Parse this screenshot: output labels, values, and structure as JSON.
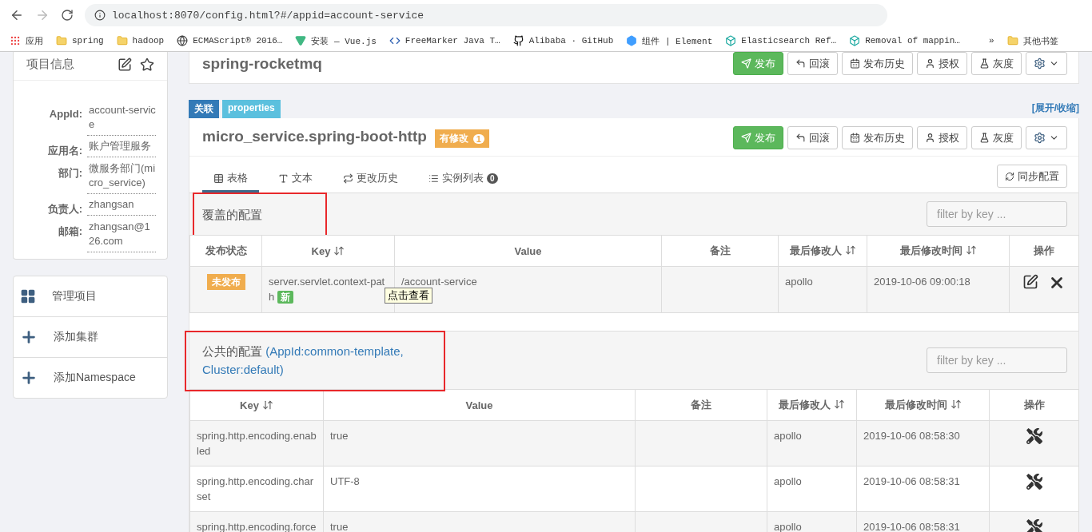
{
  "browser": {
    "address": "localhost:8070/config.html?#/appid=account-service",
    "bookmarks": [
      {
        "label": "应用",
        "kind": "apps"
      },
      {
        "label": "spring",
        "kind": "folder"
      },
      {
        "label": "hadoop",
        "kind": "folder"
      },
      {
        "label": "ECMAScript® 2016…",
        "kind": "globe"
      },
      {
        "label": "安装 — Vue.js",
        "kind": "vue"
      },
      {
        "label": "FreeMarker Java T…",
        "kind": "code"
      },
      {
        "label": "Alibaba · GitHub",
        "kind": "github"
      },
      {
        "label": "组件 | Element",
        "kind": "element"
      },
      {
        "label": "Elasticsearch Ref…",
        "kind": "elastic"
      },
      {
        "label": "Removal of mappin…",
        "kind": "elastic"
      }
    ],
    "overflow": "»",
    "other_bookmarks": "其他书签"
  },
  "sidebar": {
    "title": "项目信息",
    "fields": [
      {
        "label": "AppId:",
        "value": "account-service"
      },
      {
        "label": "应用名:",
        "value": "账户管理服务"
      },
      {
        "label": "部门:",
        "value": "微服务部门(micro_service)"
      },
      {
        "label": "负责人:",
        "value": "zhangsan"
      },
      {
        "label": "邮箱:",
        "value": "zhangsan@126.com"
      }
    ],
    "actions": [
      {
        "label": "管理项目",
        "kind": "grid"
      },
      {
        "label": "添加集群",
        "kind": "plus"
      },
      {
        "label": "添加Namespace",
        "kind": "plus"
      }
    ]
  },
  "top_namespace": {
    "title": "spring-rocketmq",
    "buttons": [
      {
        "label": "发布",
        "kind": "publish"
      },
      {
        "label": "回滚",
        "kind": "rollback"
      },
      {
        "label": "发布历史",
        "kind": "history"
      },
      {
        "label": "授权",
        "kind": "grant"
      },
      {
        "label": "灰度",
        "kind": "gray"
      },
      {
        "kind": "settings"
      }
    ]
  },
  "tags": [
    {
      "label": "关联",
      "kind": "link"
    },
    {
      "label": "properties",
      "kind": "format"
    }
  ],
  "toggle": "[展开/收缩]",
  "namespace": {
    "title": "micro_service.spring-boot-http",
    "badge": {
      "label": "有修改",
      "count": "1"
    },
    "buttons": [
      {
        "label": "发布",
        "kind": "publish"
      },
      {
        "label": "回滚",
        "kind": "rollback"
      },
      {
        "label": "发布历史",
        "kind": "history"
      },
      {
        "label": "授权",
        "kind": "grant"
      },
      {
        "label": "灰度",
        "kind": "gray"
      },
      {
        "kind": "settings"
      }
    ],
    "tabs": [
      {
        "label": "表格",
        "kind": "table",
        "selected": true
      },
      {
        "label": "文本",
        "kind": "text",
        "selected": false
      },
      {
        "label": "更改历史",
        "kind": "history",
        "selected": false
      },
      {
        "label": "实例列表",
        "kind": "instances",
        "selected": false,
        "count": "0"
      }
    ],
    "sync_button": "同步配置"
  },
  "overridden": {
    "title": "覆盖的配置",
    "highlighted": true,
    "filter_placeholder": "filter by key ...",
    "columns": [
      {
        "label": "发布状态",
        "sortable": false
      },
      {
        "label": "Key",
        "sortable": true
      },
      {
        "label": "Value",
        "sortable": false
      },
      {
        "label": "备注",
        "sortable": false
      },
      {
        "label": "最后修改人",
        "sortable": true
      },
      {
        "label": "最后修改时间",
        "sortable": true
      },
      {
        "label": "操作",
        "sortable": false
      }
    ],
    "rows": [
      {
        "status": "未发布",
        "key": "server.servlet.context-path",
        "new_tag": "新",
        "value": "/account-service",
        "modifier": "apollo",
        "time": "2019-10-06 09:00:18"
      }
    ],
    "tooltip": "点击查看"
  },
  "public": {
    "title": "公共的配置",
    "source": "(AppId:common-template, Cluster:default)",
    "highlighted": true,
    "filter_placeholder": "filter by key ...",
    "columns": [
      {
        "label": "Key",
        "sortable": true
      },
      {
        "label": "Value",
        "sortable": false
      },
      {
        "label": "备注",
        "sortable": false
      },
      {
        "label": "最后修改人",
        "sortable": true
      },
      {
        "label": "最后修改时间",
        "sortable": true
      },
      {
        "label": "操作",
        "sortable": false
      }
    ],
    "rows": [
      {
        "key": "spring.http.encoding.enabled",
        "value": "true",
        "modifier": "apollo",
        "time": "2019-10-06 08:58:30"
      },
      {
        "key": "spring.http.encoding.charset",
        "value": "UTF-8",
        "modifier": "apollo",
        "time": "2019-10-06 08:58:31"
      },
      {
        "key": "spring.http.encoding.force",
        "value": "true",
        "modifier": "apollo",
        "time": "2019-10-06 08:58:31"
      }
    ]
  }
}
